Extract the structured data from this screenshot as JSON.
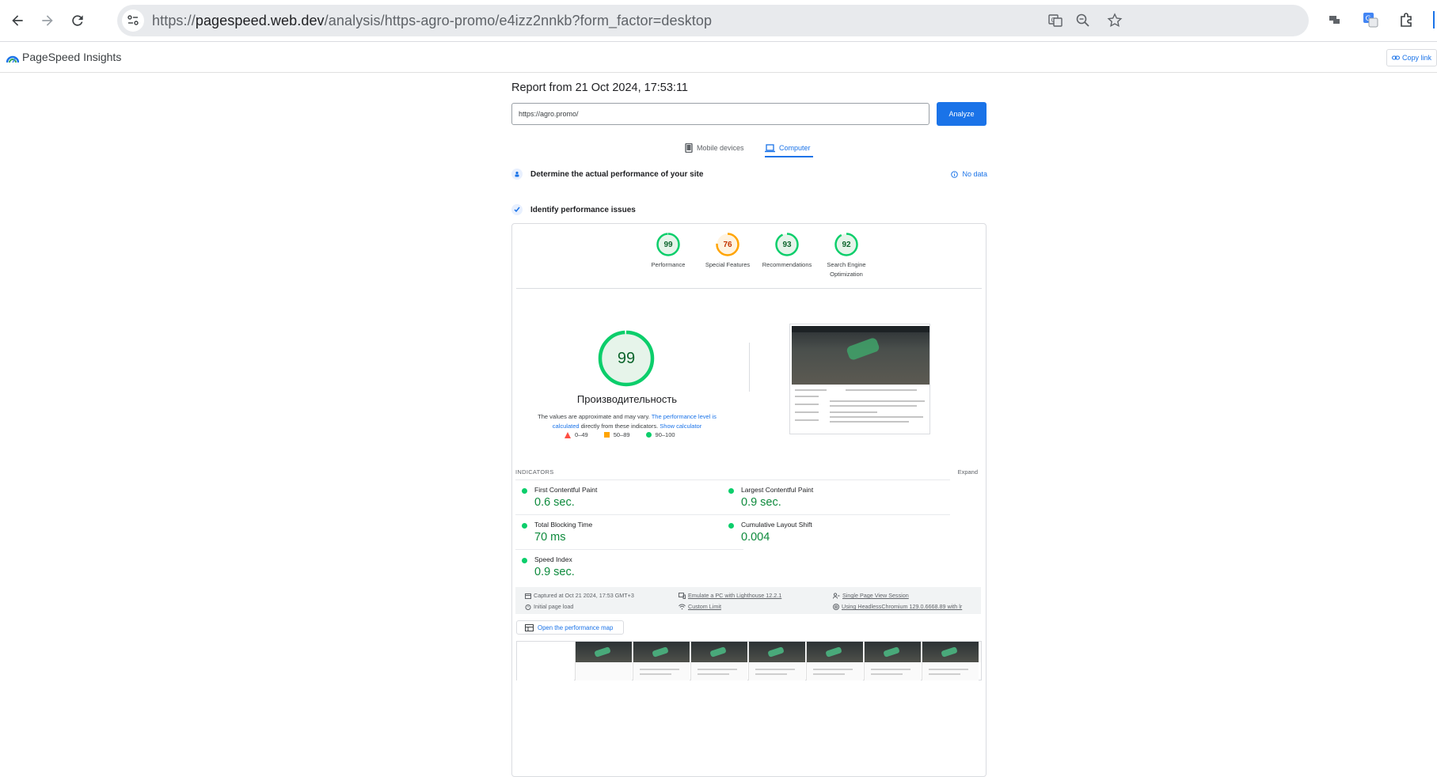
{
  "browser": {
    "url_prefix": "https://",
    "url_host": "pagespeed.web.dev",
    "url_path": "/analysis/https-agro-promo/e4izz2nnkb?form_factor=desktop",
    "icons": [
      "back-arrow-icon",
      "forward-arrow-icon",
      "reload-icon",
      "site-info-icon",
      "translate-icon",
      "zoom-icon",
      "bookmark-star-icon",
      "extension-icon",
      "google-translate-icon",
      "puzzle-icon"
    ]
  },
  "header": {
    "title": "PageSpeed Insights",
    "copy_link": "Copy link"
  },
  "report": {
    "title": "Report from 21 Oct 2024, 17:53:11",
    "url_value": "https://agro.promo/",
    "analyze_label": "Analyze",
    "tabs": [
      {
        "label": "Mobile devices",
        "active": false
      },
      {
        "label": "Computer",
        "active": true
      }
    ],
    "section_field": "Determine the actual performance of your site",
    "no_data": "No data",
    "section_lab": "Identify performance issues"
  },
  "scores": [
    {
      "value": "99",
      "label": "Performance",
      "fraction": 0.99,
      "color": "#0cce6b",
      "text_color": "#0d652d",
      "fill": "#e6f4ea"
    },
    {
      "value": "76",
      "label": "Special Features",
      "fraction": 0.76,
      "color": "#ffa400",
      "text_color": "#c33300",
      "fill": "#fff3e0"
    },
    {
      "value": "93",
      "label": "Recommendations",
      "fraction": 0.93,
      "color": "#0cce6b",
      "text_color": "#0d652d",
      "fill": "#e6f4ea"
    },
    {
      "value": "92",
      "label_line1": "Search Engine",
      "label_line2": "Optimization",
      "fraction": 0.92,
      "color": "#0cce6b",
      "text_color": "#0d652d",
      "fill": "#e6f4ea"
    }
  ],
  "performance": {
    "score": "99",
    "fraction": 0.99,
    "title": "Производительность",
    "desc_1": "The values are approximate and may vary.",
    "desc_link_1": "The performance level is calculated",
    "desc_2": "directly from these indicators.",
    "desc_link_2": "Show calculator",
    "legend": [
      "0–49",
      "50–89",
      "90–100"
    ]
  },
  "indicators": {
    "heading": "INDICATORS",
    "expand": "Expand",
    "metrics": [
      {
        "name": "First Contentful Paint",
        "value": "0.6 sec."
      },
      {
        "name": "Largest Contentful Paint",
        "value": "0.9 sec."
      },
      {
        "name": "Total Blocking Time",
        "value": "70 ms"
      },
      {
        "name": "Cumulative Layout Shift",
        "value": "0.004"
      },
      {
        "name": "Speed Index",
        "value": "0.9 sec."
      }
    ]
  },
  "meta": {
    "captured": "Captured at Oct 21 2024, 17:53 GMT+3",
    "initial_load": "Initial page load",
    "emulate": "Emulate a PC with Lighthouse 12.2.1",
    "custom_limit": "Custom Limit",
    "session": "Single Page View Session",
    "browser": "Using HeadlessChromium 129.0.6668.89 with lr"
  },
  "perf_map": "Open the performance map",
  "colors": {
    "accent": "#1a73e8",
    "good": "#0cce6b",
    "average": "#ffa400",
    "poor": "#ff4e42"
  }
}
